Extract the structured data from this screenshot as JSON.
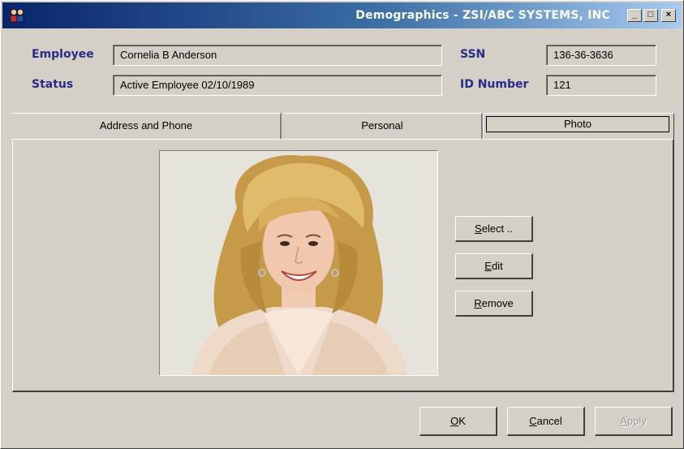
{
  "window": {
    "title": "Demographics - ZSI/ABC SYSTEMS, INC",
    "controls": {
      "minimize": "_",
      "maximize": "□",
      "close": "×"
    }
  },
  "header": {
    "employee_label": "Employee",
    "employee_value": "Cornelia B Anderson",
    "status_label": "Status",
    "status_value": "Active Employee 02/10/1989",
    "ssn_label": "SSN",
    "ssn_value": "136-36-3636",
    "id_label": "ID Number",
    "id_value": "121"
  },
  "tabs": [
    {
      "label": "Address and Phone",
      "active": false
    },
    {
      "label": "Personal",
      "active": false
    },
    {
      "label": "Photo",
      "active": true
    }
  ],
  "photo_panel": {
    "select": {
      "accel": "S",
      "rest": "elect .."
    },
    "edit": {
      "accel": "E",
      "rest": "dit"
    },
    "remove": {
      "accel": "R",
      "rest": "emove"
    }
  },
  "footer": {
    "ok": {
      "accel": "O",
      "rest": "K"
    },
    "cancel": {
      "accel": "C",
      "rest": "ancel"
    },
    "apply": {
      "accel": "A",
      "rest": "pply",
      "enabled": false
    }
  },
  "colors": {
    "title_start": "#0a246a",
    "title_end": "#a6caf0",
    "label_color": "#2a2a8a",
    "dialog_bg": "#d4d0c8"
  }
}
